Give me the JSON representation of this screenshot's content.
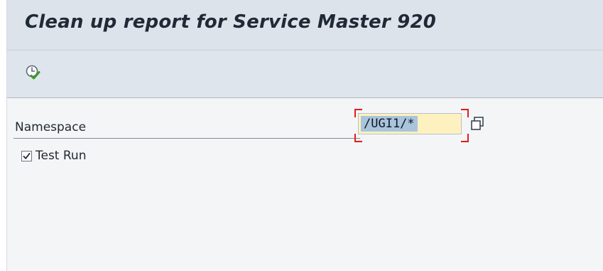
{
  "window": {
    "title": "Clean up report for Service Master 920"
  },
  "toolbar": {
    "execute_icon": "clock-execute-icon"
  },
  "selection": {
    "namespace_label": "Namespace",
    "namespace_value": "/UGI1/*",
    "namespace_multiple_icon": "multiple-selection-icon",
    "test_run_label": "Test Run",
    "test_run_checked": true
  },
  "colors": {
    "title_bar_bg": "#dde3ea",
    "toolbar_bg": "#dfe5ec",
    "content_bg": "#f4f5f7",
    "input_bg": "#fdf2bf",
    "input_selection": "#a9c4dd",
    "required_bracket": "#e11d1d",
    "execute_check": "#3a9a2a"
  }
}
